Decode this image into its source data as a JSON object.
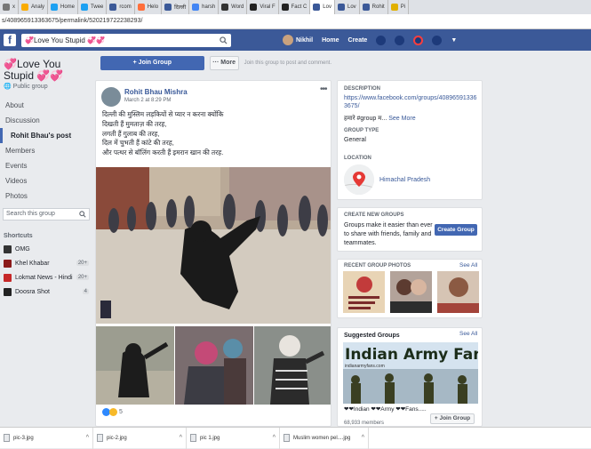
{
  "browser": {
    "tabs": [
      {
        "label": "x",
        "color": "#777"
      },
      {
        "label": "Analy",
        "color": "#f9ab00"
      },
      {
        "label": "Home",
        "color": "#1da1f2"
      },
      {
        "label": "Twee",
        "color": "#1da1f2"
      },
      {
        "label": "rcom",
        "color": "#3b5998"
      },
      {
        "label": "Helo",
        "color": "#ff6f3c"
      },
      {
        "label": "दिल्ली",
        "color": "#3b5998"
      },
      {
        "label": "harsh",
        "color": "#4285f4"
      },
      {
        "label": "Word",
        "color": "#333333"
      },
      {
        "label": "Viral F",
        "color": "#222222"
      },
      {
        "label": "Fact C",
        "color": "#222222"
      },
      {
        "label": "Lov",
        "color": "#3b5998",
        "active": true
      },
      {
        "label": "Lov",
        "color": "#3b5998"
      },
      {
        "label": "Rohit",
        "color": "#3b5998"
      },
      {
        "label": "Pi",
        "color": "#e1b000"
      }
    ],
    "url": "s/408965913363675/permalink/520219722238293/"
  },
  "fb_header": {
    "logo": "f",
    "search_value": "💞Love You Stupid 💞💞",
    "user": "Nikhil",
    "home": "Home",
    "create": "Create",
    "brand_color": "#3b5998"
  },
  "group": {
    "title": "💞Love You Stupid 💞💞",
    "privacy": "Public group",
    "nav": [
      "About",
      "Discussion",
      "Rohit Bhau's post",
      "Members",
      "Events",
      "Videos",
      "Photos"
    ],
    "search_placeholder": "Search this group",
    "shortcuts_title": "Shortcuts",
    "shortcuts": [
      {
        "label": "OMG",
        "badge": "",
        "color": "#333333"
      },
      {
        "label": "Khel Khabar",
        "badge": "20+",
        "color": "#8b1a1a"
      },
      {
        "label": "Lokmat News - Hindi",
        "badge": "20+",
        "color": "#c62828"
      },
      {
        "label": "Doosra Shot",
        "badge": "4",
        "color": "#222222"
      }
    ],
    "join_label": "+ Join Group",
    "more_label": "··· More",
    "join_hint": "Join this group to post and comment."
  },
  "post": {
    "author": "Rohit Bhau Mishra",
    "date": "March 2 at 8:29 PM",
    "lines": [
      "दिल्ली की मुस्लिम लड़कियों से प्यार न करना क्योंकि",
      "दिखती हैं मुमताज़ की तरह,",
      "लगती हैं गुलाब की तरह,",
      "दिल में चुभती हैं कांटे की तरह,",
      "और पत्थर से बॉलिंग करती हैं इमरान खान की तरह."
    ],
    "reaction_count": "5"
  },
  "sidebar": {
    "description_title": "DESCRIPTION",
    "description_link": "https://www.facebook.com/groups/408965913363675/",
    "description_text": "हमारे #group म...",
    "see_more": "See More",
    "group_type_title": "GROUP TYPE",
    "group_type": "General",
    "location_title": "LOCATION",
    "location": "Himachal Pradesh",
    "create_title": "CREATE NEW GROUPS",
    "create_text": "Groups make it easier than ever to share with friends, family and teammates.",
    "create_btn": "Create Group",
    "photos_title": "RECENT GROUP PHOTOS",
    "see_all": "See All",
    "suggested_title": "Suggested Groups",
    "suggested_see_all": "See All",
    "banner_text": "Indian Army Fans",
    "banner_sub": "indianarmyfans.com",
    "suggested_name": "❤❤Indian ❤❤Army ❤❤Fans.....",
    "suggested_join": "+ Join Group",
    "suggested_members": "68,933 members"
  },
  "downloads": [
    {
      "name": "pic-3.jpg"
    },
    {
      "name": "pic-2.jpg"
    },
    {
      "name": "pic 1.jpg"
    },
    {
      "name": "Muslim women pel....jpg"
    }
  ]
}
